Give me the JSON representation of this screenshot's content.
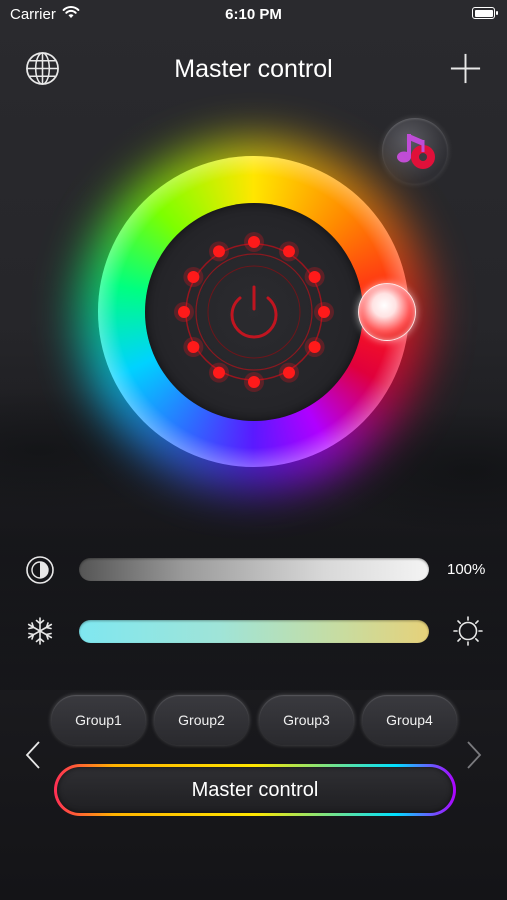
{
  "status_bar": {
    "carrier": "Carrier",
    "time": "6:10 PM"
  },
  "header": {
    "title": "Master control"
  },
  "icons": {
    "language": "globe-icon",
    "add": "plus-icon",
    "music": "music-note-icon",
    "power": "power-icon",
    "brightness": "contrast-half-circle-icon",
    "cold": "snowflake-icon",
    "warm": "sun-icon"
  },
  "color_wheel": {
    "selected_color": "#ff1a1a"
  },
  "brightness": {
    "value_label": "100%",
    "value": 1.0
  },
  "color_temperature": {
    "cold_color": "#7fe7f0",
    "warm_color": "#e6d17a"
  },
  "groups": [
    {
      "label": "Group1"
    },
    {
      "label": "Group2"
    },
    {
      "label": "Group3"
    },
    {
      "label": "Group4"
    }
  ],
  "master_button": {
    "label": "Master control"
  },
  "colors": {
    "accent": "#ff1a1a",
    "background": "#242428"
  }
}
